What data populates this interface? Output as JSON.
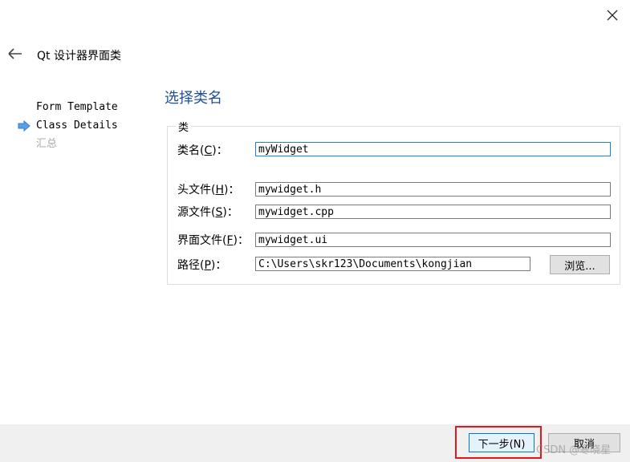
{
  "window": {
    "close_icon": "close-icon"
  },
  "header": {
    "back_icon": "back-arrow-icon",
    "title": "Qt 设计器界面类"
  },
  "steps": [
    {
      "label": "Form Template",
      "state": "done"
    },
    {
      "label": "Class Details",
      "state": "current"
    },
    {
      "label": "汇总",
      "state": "pending"
    }
  ],
  "page": {
    "title": "选择类名",
    "group_title": "类",
    "fields": {
      "class_name": {
        "label_prefix": "类名(",
        "mnemonic": "C",
        "label_suffix": ")：",
        "value": "myWidget"
      },
      "header_file": {
        "label_prefix": "头文件(",
        "mnemonic": "H",
        "label_suffix": ")：",
        "value": "mywidget.h"
      },
      "source_file": {
        "label_prefix": "源文件(",
        "mnemonic": "S",
        "label_suffix": ")：",
        "value": "mywidget.cpp"
      },
      "form_file": {
        "label_prefix": "界面文件(",
        "mnemonic": "F",
        "label_suffix": ")：",
        "value": "mywidget.ui"
      },
      "path": {
        "label_prefix": "路径(",
        "mnemonic": "P",
        "label_suffix": ")：",
        "value": "C:\\Users\\skr123\\Documents\\kongjian"
      }
    },
    "browse_label": "浏览..."
  },
  "footer": {
    "next_label": "下一步(N)",
    "cancel_label": "取消"
  },
  "watermark": "CSDN @寒晓星",
  "colors": {
    "accent": "#1e4f98",
    "highlight": "#e0191d",
    "focus": "#1c7fd8",
    "arrow": "#2f7fd6"
  }
}
